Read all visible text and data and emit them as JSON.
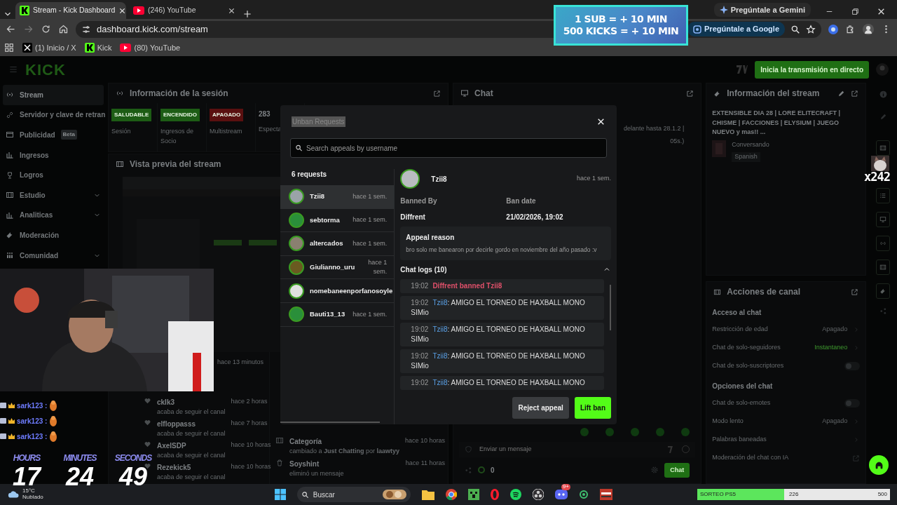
{
  "browser": {
    "tabs": [
      {
        "title": "Stream - Kick Dashboard",
        "selected": true
      },
      {
        "title": "(246) YouTube",
        "selected": false
      }
    ],
    "gemini_button": "Pregúntale a Gemini",
    "address": "dashboard.kick.com/stream",
    "google_button": "Pregúntale a Google",
    "bookmarks": [
      {
        "label": "(1) Inicio / X"
      },
      {
        "label": "Kick"
      },
      {
        "label": "(80) YouTube"
      }
    ]
  },
  "app": {
    "logo": "KICK",
    "go_live_button": "Inicia la transmisión en directo",
    "sidebar": [
      {
        "label": "Stream",
        "selected": true,
        "expandable": false
      },
      {
        "label": "Servidor y clave de retran",
        "selected": false,
        "expandable": false
      },
      {
        "label": "Publicidad",
        "badge": "Beta",
        "selected": false,
        "expandable": false
      },
      {
        "label": "Ingresos",
        "selected": false,
        "expandable": false
      },
      {
        "label": "Logros",
        "selected": false,
        "expandable": false
      },
      {
        "label": "Estudio",
        "selected": false,
        "expandable": true
      },
      {
        "label": "Analiticas",
        "selected": false,
        "expandable": true
      },
      {
        "label": "Moderación",
        "selected": false,
        "expandable": false
      },
      {
        "label": "Comunidad",
        "selected": false,
        "expandable": true
      }
    ],
    "session_panel": {
      "title": "Información de la sesión",
      "stats": [
        {
          "badge": "SALUDABLE",
          "color": "#1d5c15",
          "label": "Sesión"
        },
        {
          "badge": "ENCENDIDO",
          "color": "#1d5c15",
          "label": "Ingresos de Socio"
        },
        {
          "badge": "APAGADO",
          "color": "#5a1010",
          "label": "Multistream"
        },
        {
          "value": "283",
          "label": "Especta"
        }
      ]
    },
    "preview_panel": {
      "title": "Vista previa del stream"
    },
    "activity": {
      "time": "hace 13 minutos",
      "items": [
        {
          "user": "ckIk3",
          "action": "acaba de seguir el canal",
          "time": "hace 2 horas"
        },
        {
          "user": "elfloppasss",
          "action": "acaba de seguir el canal",
          "time": "hace 7 horas"
        },
        {
          "user": "AxelSDP",
          "action": "acaba de seguir el canal",
          "time": "hace 10 horas"
        },
        {
          "user": "Rezekick5",
          "action": "acaba de seguir el canal",
          "time": "hace 10 horas"
        }
      ]
    },
    "mod_log": [
      {
        "title": "Categoría",
        "detail": "cambiado a **Just Chatting** por **laawtyy**",
        "time": "hace 10 horas"
      },
      {
        "title": "Soyshint",
        "detail": "eliminó un mensaje",
        "time": "hace 11 horas"
      }
    ],
    "chat_panel": {
      "title": "Chat",
      "pinned": "delante hasta 28.1.2 |",
      "pinned_2": "05s.)",
      "placeholder": "Enviar un mensaje",
      "count": "0",
      "send_button": "Chat"
    },
    "stream_info": {
      "title": "Información del stream",
      "stream_title": "EXTENSIBLE DIA 28 | LORE ELITECRAFT | CHISME | FACCIONES | ELYSIUM | JUEGO NUEVO y mas!! ...",
      "category": "Conversando",
      "tag": "Spanish"
    },
    "channel_actions": {
      "title": "Acciones de canal",
      "sections": [
        {
          "title": "Acceso al chat",
          "rows": [
            {
              "label": "Restricción de edad",
              "kind": "select",
              "value": "Apagado",
              "active": false
            },
            {
              "label": "Chat de solo-seguidores",
              "kind": "select",
              "value": "Instantaneo",
              "active": true
            },
            {
              "label": "Chat de solo-suscriptores",
              "kind": "toggle",
              "on": false
            }
          ]
        },
        {
          "title": "Opciones del chat",
          "rows": [
            {
              "label": "Chat de solo-emotes",
              "kind": "toggle",
              "on": false
            },
            {
              "label": "Modo lento",
              "kind": "select",
              "value": "Apagado",
              "active": false
            },
            {
              "label": "Palabras baneadas",
              "kind": "link"
            },
            {
              "label": "Moderación del chat con IA",
              "kind": "external"
            }
          ]
        }
      ]
    }
  },
  "modal": {
    "title": "Unban Requests",
    "search_placeholder": "Search appeals by username",
    "count": "6 requests",
    "requests": [
      {
        "name": "Tzii8",
        "time": "hace 1 sem.",
        "selected": true
      },
      {
        "name": "sebtorma",
        "time": "hace 1 sem.",
        "selected": false
      },
      {
        "name": "altercados",
        "time": "hace 1 sem.",
        "selected": false
      },
      {
        "name": "Giulianno_uru",
        "time": "hace 1 sem.",
        "selected": false
      },
      {
        "name": "nomebaneenporfanosoyle",
        "selected": false
      },
      {
        "name": "Bauti13_13",
        "time": "hace 1 sem.",
        "selected": false
      }
    ],
    "detail": {
      "name": "Tzii8",
      "time": "hace 1 sem.",
      "banned_by_label": "Banned By",
      "banned_by": "Diffrent",
      "ban_date_label": "Ban date",
      "ban_date": "21/02/2026, 19:02",
      "appeal_title": "Appeal reason",
      "appeal_text": "bro solo me banearon por decirle gordo en noviembre del año pasado :v",
      "logs_title": "Chat logs (10)",
      "logs_expanded": true,
      "logs": [
        {
          "kind": "ban",
          "time": "19:02",
          "text": "Diffrent banned Tzii8"
        },
        {
          "kind": "message",
          "time": "19:02",
          "user": "Tzii8",
          "text": ": AMIGO EL TORNEO DE HAXBALL MONO SIMio"
        },
        {
          "kind": "message",
          "time": "19:02",
          "user": "Tzii8",
          "text": ": AMIGO EL TORNEO DE HAXBALL MONO SIMio"
        },
        {
          "kind": "message",
          "time": "19:02",
          "user": "Tzii8",
          "text": ": AMIGO EL TORNEO DE HAXBALL MONO SIMio"
        },
        {
          "kind": "message",
          "time": "19:02",
          "user": "Tzii8",
          "text": ": AMIGO EL TORNEO DE HAXBALL MONO"
        }
      ]
    },
    "reject_button": "Reject appeal",
    "lift_button": "Lift ban"
  },
  "overlays": {
    "banner": [
      "1 SUB = + 10 MIN",
      "500 KICKS = + 10 MIN"
    ],
    "chat": [
      {
        "user": "sark123 :"
      },
      {
        "user": "sark123 :"
      },
      {
        "user": "sark123 :"
      }
    ],
    "timer": [
      {
        "label": "HOURS",
        "value": "17"
      },
      {
        "label": "MINUTES",
        "value": "24"
      },
      {
        "label": "SECONDS",
        "value": "49"
      }
    ],
    "alert_count": "x242"
  },
  "taskbar": {
    "temperature": "15°C",
    "weather": "Nublado",
    "search": "Buscar",
    "discord_badge": "9+",
    "giveaway": {
      "label": "SORTEO PS5",
      "current": "226",
      "goal": "500",
      "level": 0.452
    }
  }
}
